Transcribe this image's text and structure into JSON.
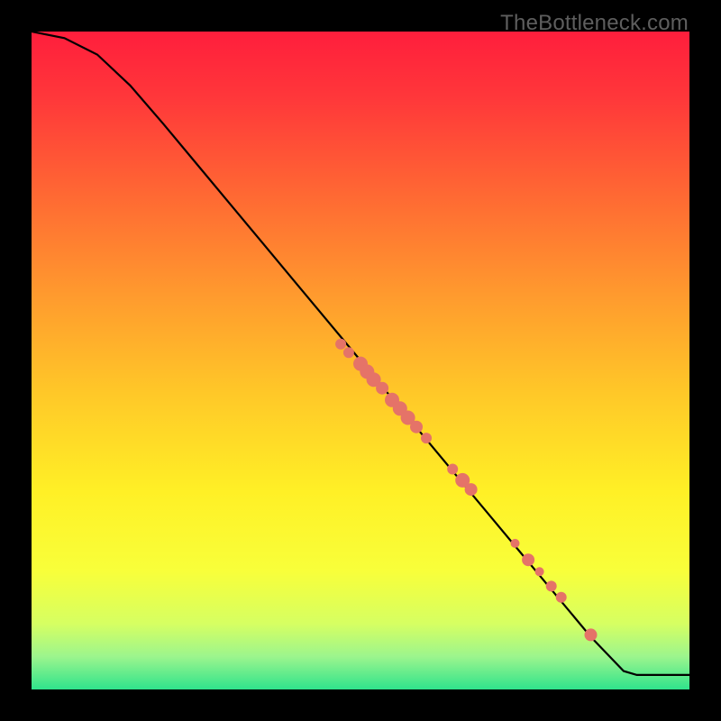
{
  "watermark": "TheBottleneck.com",
  "chart_data": {
    "type": "line",
    "title": "",
    "xlabel": "",
    "ylabel": "",
    "xlim": [
      0,
      1
    ],
    "ylim": [
      0,
      1
    ],
    "curve": [
      {
        "x": 0.0,
        "y": 1.0
      },
      {
        "x": 0.05,
        "y": 0.99
      },
      {
        "x": 0.1,
        "y": 0.965
      },
      {
        "x": 0.15,
        "y": 0.918
      },
      {
        "x": 0.2,
        "y": 0.86
      },
      {
        "x": 0.25,
        "y": 0.8
      },
      {
        "x": 0.3,
        "y": 0.74
      },
      {
        "x": 0.35,
        "y": 0.68
      },
      {
        "x": 0.4,
        "y": 0.62
      },
      {
        "x": 0.45,
        "y": 0.56
      },
      {
        "x": 0.5,
        "y": 0.5
      },
      {
        "x": 0.55,
        "y": 0.44
      },
      {
        "x": 0.6,
        "y": 0.38
      },
      {
        "x": 0.65,
        "y": 0.32
      },
      {
        "x": 0.7,
        "y": 0.26
      },
      {
        "x": 0.75,
        "y": 0.2
      },
      {
        "x": 0.8,
        "y": 0.14
      },
      {
        "x": 0.85,
        "y": 0.08
      },
      {
        "x": 0.9,
        "y": 0.028
      },
      {
        "x": 0.92,
        "y": 0.022
      },
      {
        "x": 1.0,
        "y": 0.022
      }
    ],
    "points": [
      {
        "x": 0.47,
        "y": 0.525,
        "r": 6
      },
      {
        "x": 0.482,
        "y": 0.512,
        "r": 6
      },
      {
        "x": 0.5,
        "y": 0.495,
        "r": 8
      },
      {
        "x": 0.51,
        "y": 0.483,
        "r": 8
      },
      {
        "x": 0.52,
        "y": 0.471,
        "r": 8
      },
      {
        "x": 0.533,
        "y": 0.458,
        "r": 7
      },
      {
        "x": 0.548,
        "y": 0.44,
        "r": 8
      },
      {
        "x": 0.56,
        "y": 0.427,
        "r": 8
      },
      {
        "x": 0.572,
        "y": 0.413,
        "r": 8
      },
      {
        "x": 0.585,
        "y": 0.399,
        "r": 7
      },
      {
        "x": 0.6,
        "y": 0.382,
        "r": 6
      },
      {
        "x": 0.64,
        "y": 0.335,
        "r": 6
      },
      {
        "x": 0.655,
        "y": 0.318,
        "r": 8
      },
      {
        "x": 0.668,
        "y": 0.304,
        "r": 7
      },
      {
        "x": 0.735,
        "y": 0.222,
        "r": 5
      },
      {
        "x": 0.755,
        "y": 0.197,
        "r": 7
      },
      {
        "x": 0.772,
        "y": 0.179,
        "r": 5
      },
      {
        "x": 0.79,
        "y": 0.157,
        "r": 6
      },
      {
        "x": 0.805,
        "y": 0.14,
        "r": 6
      },
      {
        "x": 0.85,
        "y": 0.083,
        "r": 7
      }
    ],
    "gradient_stops": [
      {
        "offset": 0.0,
        "color": "#ff1e3c"
      },
      {
        "offset": 0.1,
        "color": "#ff373a"
      },
      {
        "offset": 0.25,
        "color": "#ff6933"
      },
      {
        "offset": 0.4,
        "color": "#ff9a2e"
      },
      {
        "offset": 0.55,
        "color": "#ffc828"
      },
      {
        "offset": 0.7,
        "color": "#fff026"
      },
      {
        "offset": 0.82,
        "color": "#f8ff3a"
      },
      {
        "offset": 0.9,
        "color": "#d6ff62"
      },
      {
        "offset": 0.95,
        "color": "#9cf58d"
      },
      {
        "offset": 1.0,
        "color": "#2fe38c"
      }
    ],
    "point_color": "#e57368",
    "line_color": "#000000"
  }
}
